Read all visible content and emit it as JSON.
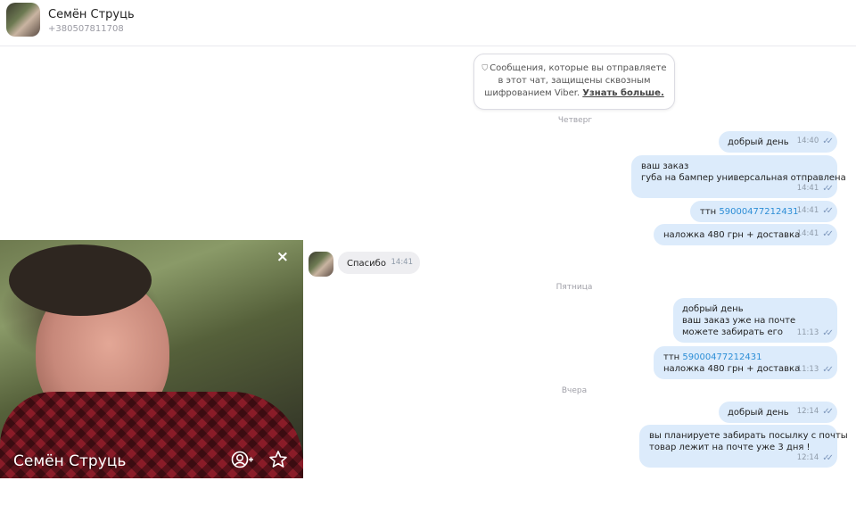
{
  "header": {
    "name": "Семён Струць",
    "phone": "+380507811708"
  },
  "notice": {
    "text": "Сообщения, которые вы отправляете в этот чат, защищены сквозным шифрованием Viber.",
    "link": "Узнать больше."
  },
  "dates": [
    "Четверг",
    "Пятница",
    "Вчера"
  ],
  "messages": [
    {
      "lines": [
        "добрый день"
      ],
      "time": "14:40"
    },
    {
      "lines": [
        "ваш заказ",
        "губа на бампер универсальная отправлена"
      ],
      "time": "14:41"
    },
    {
      "prefix": "ттн ",
      "link": "59000477212431",
      "time": "14:41"
    },
    {
      "lines": [
        "наложка 480 грн + доставка"
      ],
      "time": "14:41"
    },
    {
      "lines": [
        "Спасибо"
      ],
      "time": "14:41"
    },
    {
      "lines": [
        "добрый день",
        "ваш заказ уже на почте",
        "можете забирать его"
      ],
      "time": "11:13"
    },
    {
      "prefix": "ттн ",
      "link": "59000477212431",
      "line2": "наложка 480 грн + доставка",
      "time": "11:13"
    },
    {
      "lines": [
        "добрый день"
      ],
      "time": "12:14"
    },
    {
      "lines": [
        "вы планируете забирать посылку с почты",
        "товар лежит на почте уже 3 дня !"
      ],
      "time": "12:14"
    }
  ],
  "profile": {
    "name": "Семён Струць",
    "close": "×"
  },
  "icons": {
    "read": "double-check-icon",
    "shield": "shield-icon",
    "add_contact": "add-contact-icon",
    "favorite": "star-icon"
  }
}
